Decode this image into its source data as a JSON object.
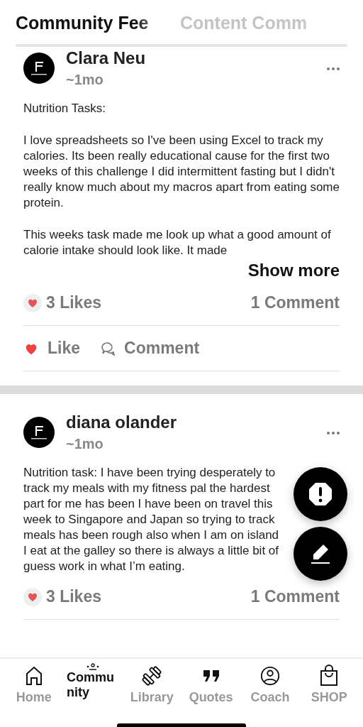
{
  "tabs": [
    {
      "label": "Community Fee",
      "selected": true
    },
    {
      "label": "Content Comm",
      "selected": false
    }
  ],
  "posts": [
    {
      "author": "Clara Neu",
      "time": "~1mo",
      "paragraphs": [
        "Nutrition Tasks:",
        "I love spreadsheets so I've been using Excel to track my calories. Its been really educational cause for the first two weeks of this challenge I did intermittent fasting but I didn't really know much about my macros apart from eating some protein.",
        "This weeks task made me look up what a good amount of calorie intake should look like. It made"
      ],
      "show_more": "Show more",
      "likes": "3 Likes",
      "comments": "1 Comment",
      "liked": true,
      "like_label": "Like",
      "comment_label": "Comment"
    },
    {
      "author": "diana olander",
      "time": "~1mo",
      "paragraphs": [
        "Nutrition task: I have been trying desperately to track my meals with my fitness pal the hardest part for me has been I have been on travel this week to Singapore and Japan so trying to track meals has been rough also when I am on island I eat at the galley so there is always a little bit of guess work in what I’m eating."
      ],
      "likes": "3 Likes",
      "comments": "1 Comment"
    }
  ],
  "nav": [
    {
      "kind": "home",
      "label": "Home",
      "selected": false
    },
    {
      "kind": "community",
      "label": "Community",
      "selected": true
    },
    {
      "kind": "library",
      "label": "Library",
      "selected": false
    },
    {
      "kind": "quotes",
      "label": "Quotes",
      "selected": false
    },
    {
      "kind": "coach",
      "label": "Coach",
      "selected": false
    },
    {
      "kind": "shop",
      "label": "SHOP",
      "selected": false
    }
  ]
}
